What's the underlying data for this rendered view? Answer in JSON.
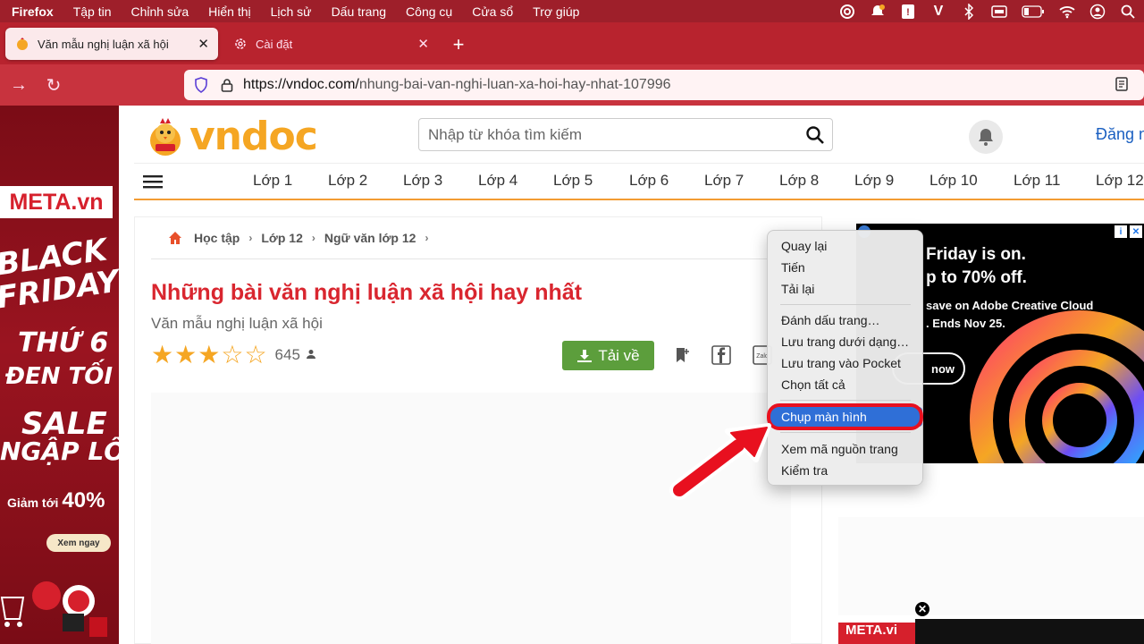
{
  "menubar": {
    "app": "Firefox",
    "items": [
      "Tập tin",
      "Chỉnh sửa",
      "Hiển thị",
      "Lịch sử",
      "Dấu trang",
      "Công cụ",
      "Cửa sổ",
      "Trợ giúp"
    ],
    "status_icons": [
      "creative-cloud-icon",
      "notification-icon",
      "bitwarden-icon",
      "v-icon",
      "bluetooth-icon",
      "keyboard-icon",
      "battery-icon",
      "wifi-icon",
      "user-icon",
      "search-icon"
    ]
  },
  "tabs": [
    {
      "title": "Văn mẫu nghị luận xã hội",
      "active": true
    },
    {
      "title": "Cài đặt",
      "active": false
    }
  ],
  "url": {
    "host": "https://vndoc.com/",
    "path": "nhung-bai-van-nghi-luan-xa-hoi-hay-nhat-107996"
  },
  "site": {
    "logo": "vndoc",
    "search_placeholder": "Nhập từ khóa tìm kiếm",
    "login": "Đăng n",
    "grades": [
      "Lớp 1",
      "Lớp 2",
      "Lớp 3",
      "Lớp 4",
      "Lớp 5",
      "Lớp 6",
      "Lớp 7",
      "Lớp 8",
      "Lớp 9",
      "Lớp 10",
      "Lớp 11",
      "Lớp 12"
    ]
  },
  "breadcrumb": [
    "Học tập",
    "Lớp 12",
    "Ngữ văn lớp 12"
  ],
  "article": {
    "title": "Những bài văn nghị luận xã hội hay nhất",
    "subtitle": "Văn mẫu nghị luận xã hội",
    "rating": 3,
    "rating_max": 5,
    "rating_count": "645",
    "download_label": "Tải về"
  },
  "left_ad": {
    "brand": "META.vn",
    "line1": "BLACK",
    "line2": "FRIDAY",
    "line3": "THỨ 6",
    "line4": "ĐEN TỐI",
    "line5": "SALE",
    "line6": "NGẬP LỐI",
    "discount_label": "Giảm tới",
    "discount_value": "40%",
    "cta": "Xem ngay"
  },
  "right_ad": {
    "line1": "Friday is on.",
    "line2": "p to 70% off.",
    "line3": "save on Adobe Creative Cloud",
    "line4": ". Ends Nov 25.",
    "button": "now"
  },
  "bottom_ad": {
    "brand": "META.vi"
  },
  "context_menu": {
    "items": [
      "Quay lại",
      "Tiến",
      "Tải lại",
      "Đánh dấu trang…",
      "Lưu trang dưới dạng…",
      "Lưu trang vào Pocket",
      "Chọn tất cả",
      "Chụp màn hình",
      "Xem mã nguồn trang",
      "Kiểm tra"
    ],
    "highlighted": "Chụp màn hình"
  },
  "colors": {
    "browser_accent": "#b8232e",
    "title_red": "#d9262f",
    "download_green": "#5c9e3c",
    "highlight_blue": "#2f6fd7",
    "annotation_red": "#e8101f"
  }
}
